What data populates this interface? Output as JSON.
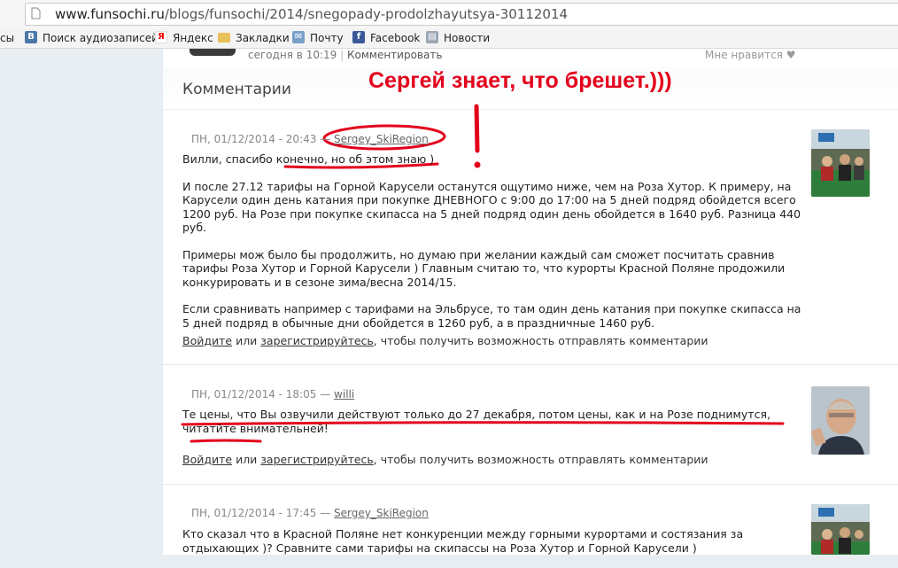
{
  "browser": {
    "url_host": "www.funsochi.ru",
    "url_path": "/blogs/funsochi/2014/snegopady-prodolzhayutsya-30112014",
    "bookmarks": [
      {
        "label": "сы",
        "icon": "none"
      },
      {
        "label": "Поиск аудиозаписей",
        "icon": "vk-icon"
      },
      {
        "label": "Яндекс",
        "icon": "yandex-icon"
      },
      {
        "label": "Закладки",
        "icon": "folder-icon"
      },
      {
        "label": "Почту",
        "icon": "mail-icon"
      },
      {
        "label": "Facebook",
        "icon": "facebook-icon"
      },
      {
        "label": "Новости",
        "icon": "news-icon"
      }
    ]
  },
  "post_meta": {
    "date": "сегодня в 10:19",
    "separator": "|",
    "comment_link": "Комментировать",
    "like_label": "Мне нравится ♥"
  },
  "comments_section": {
    "title": "Комментарии",
    "overlay_annotation": "Сергей знает, что брешет.)))",
    "overlay_exclamation": "!"
  },
  "comments": [
    {
      "date": "ПН, 01/12/2014 - 20:43",
      "dash": "—",
      "author": "Sergey_SkiRegion",
      "paragraphs": [
        "Вилли, спасибо конечно, но об этом знаю )",
        "И после 27.12 тарифы на Горной Карусели останутся ощутимо ниже, чем на Роза Хутор. К примеру, на Карусели один день катания при покупке ДНЕВНОГО с 9:00 до 17:00 на 5 дней подряд обойдется всего 1200 руб. На Розе при покупке скипасса на 5 дней подряд один день обойдется в 1640 руб. Разница 440 руб.",
        "Примеры мож было бы продолжить, но думаю при желании каждый сам сможет посчитать сравнив тарифы Роза Хутор и Горной Карусели ) Главным считаю то, что курорты Красной Поляне продожили конкурировать и в сезоне зима/весна 2014/15.",
        "Если сравнивать например с тарифами на Эльбрусе, то там один день катания при покупке скипасса на 5 дней подряд в обычные дни обойдется в 1260 руб, а в праздничные 1460 руб."
      ],
      "login": "Войдите",
      "or": " или ",
      "register": "зарегистрируйтесь",
      "tail": ", чтобы получить возможность отправлять комментарии"
    },
    {
      "date": "ПН, 01/12/2014 - 18:05",
      "dash": "—",
      "author": "willi",
      "paragraphs": [
        "Те цены, что Вы озвучили действуют только до 27 декабря, потом цены, как и на Розе поднимутся, читатйте внимательней!"
      ],
      "login": "Войдите",
      "or": " или ",
      "register": "зарегистрируйтесь",
      "tail": ", чтобы получить возможность отправлять комментарии"
    },
    {
      "date": "ПН, 01/12/2014 - 17:45",
      "dash": "—",
      "author": "Sergey_SkiRegion",
      "paragraphs": [
        "Кто сказал что в Красной Поляне нет конкуренции между горными курортами и состязания за отдыхающих )? Сравните сами тарифы на скипассы на Роза Хутор и Горной Карусели )"
      ]
    }
  ],
  "colors": {
    "annotation_red": "#e3001b",
    "page_bg": "#e8edf1"
  }
}
